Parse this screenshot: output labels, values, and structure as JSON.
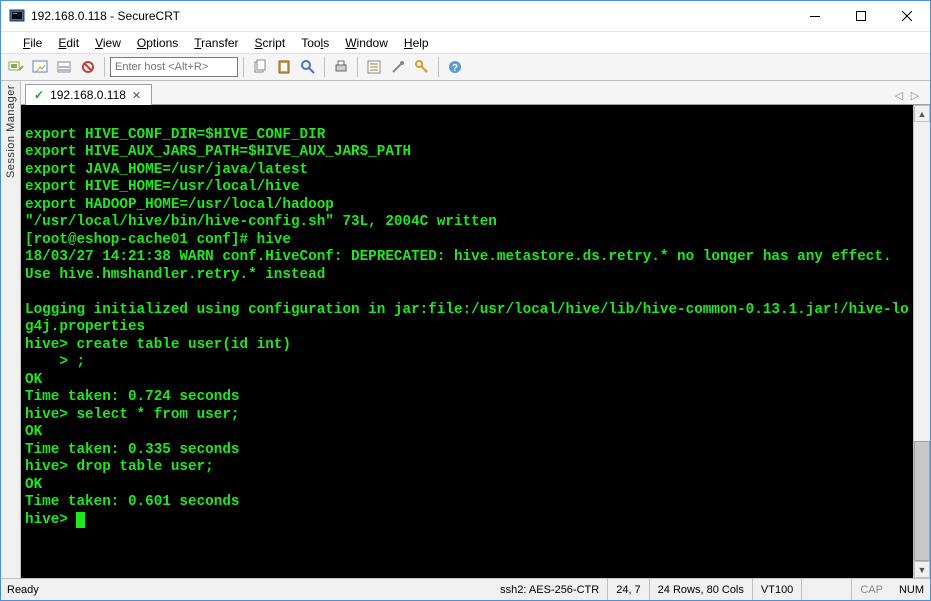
{
  "window": {
    "title": "192.168.0.118 - SecureCRT"
  },
  "menu": {
    "items": [
      "File",
      "Edit",
      "View",
      "Options",
      "Transfer",
      "Script",
      "Tools",
      "Window",
      "Help"
    ]
  },
  "toolbar": {
    "host_placeholder": "Enter host <Alt+R>"
  },
  "session_manager_label": "Session Manager",
  "tab": {
    "label": "192.168.0.118"
  },
  "terminal": {
    "lines": [
      "",
      "export HIVE_CONF_DIR=$HIVE_CONF_DIR",
      "export HIVE_AUX_JARS_PATH=$HIVE_AUX_JARS_PATH",
      "export JAVA_HOME=/usr/java/latest",
      "export HIVE_HOME=/usr/local/hive",
      "export HADOOP_HOME=/usr/local/hadoop",
      "\"/usr/local/hive/bin/hive-config.sh\" 73L, 2004C written",
      "[root@eshop-cache01 conf]# hive",
      "18/03/27 14:21:38 WARN conf.HiveConf: DEPRECATED: hive.metastore.ds.retry.* no longer has any effect.  Use hive.hmshandler.retry.* instead",
      "",
      "Logging initialized using configuration in jar:file:/usr/local/hive/lib/hive-common-0.13.1.jar!/hive-log4j.properties",
      "hive> create table user(id int)",
      "    > ;",
      "OK",
      "Time taken: 0.724 seconds",
      "hive> select * from user;",
      "OK",
      "Time taken: 0.335 seconds",
      "hive> drop table user;",
      "OK",
      "Time taken: 0.601 seconds",
      "hive> "
    ]
  },
  "status": {
    "ready": "Ready",
    "cipher": "ssh2: AES-256-CTR",
    "cursor": "24,   7",
    "size": "24 Rows, 80 Cols",
    "term": "VT100",
    "caps": "CAP",
    "num": "NUM"
  }
}
